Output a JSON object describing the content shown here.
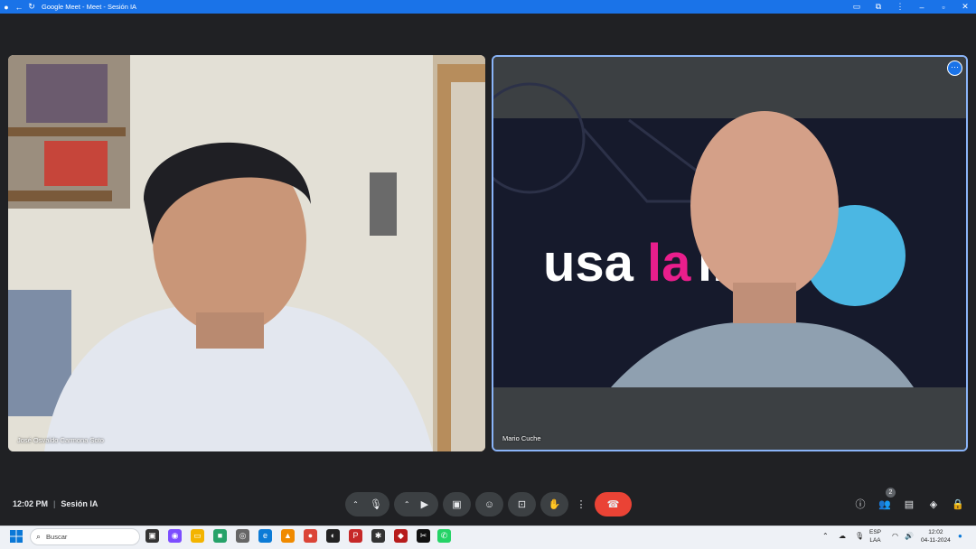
{
  "window": {
    "title": "Google Meet - Meet - Sesión IA"
  },
  "participants": [
    {
      "name": "José Osvaldo Carmona Soto"
    },
    {
      "name": "Mario Cuche"
    }
  ],
  "background_logo": {
    "pre": "usa",
    "mid": "la",
    "post": "int"
  },
  "meeting": {
    "time": "12:02 PM",
    "separator": "|",
    "title": "Sesión IA",
    "participant_count": "2"
  },
  "taskbar": {
    "search_placeholder": "Buscar",
    "lang_top": "ESP",
    "lang_bottom": "LAA",
    "time": "12:02",
    "date": "04-11-2024"
  },
  "colors": {
    "titlebar": "#1a73e8",
    "stage": "#202124",
    "end_call": "#ea4335",
    "accent_pink": "#e91e8c",
    "active_border": "#8ab4f8"
  }
}
